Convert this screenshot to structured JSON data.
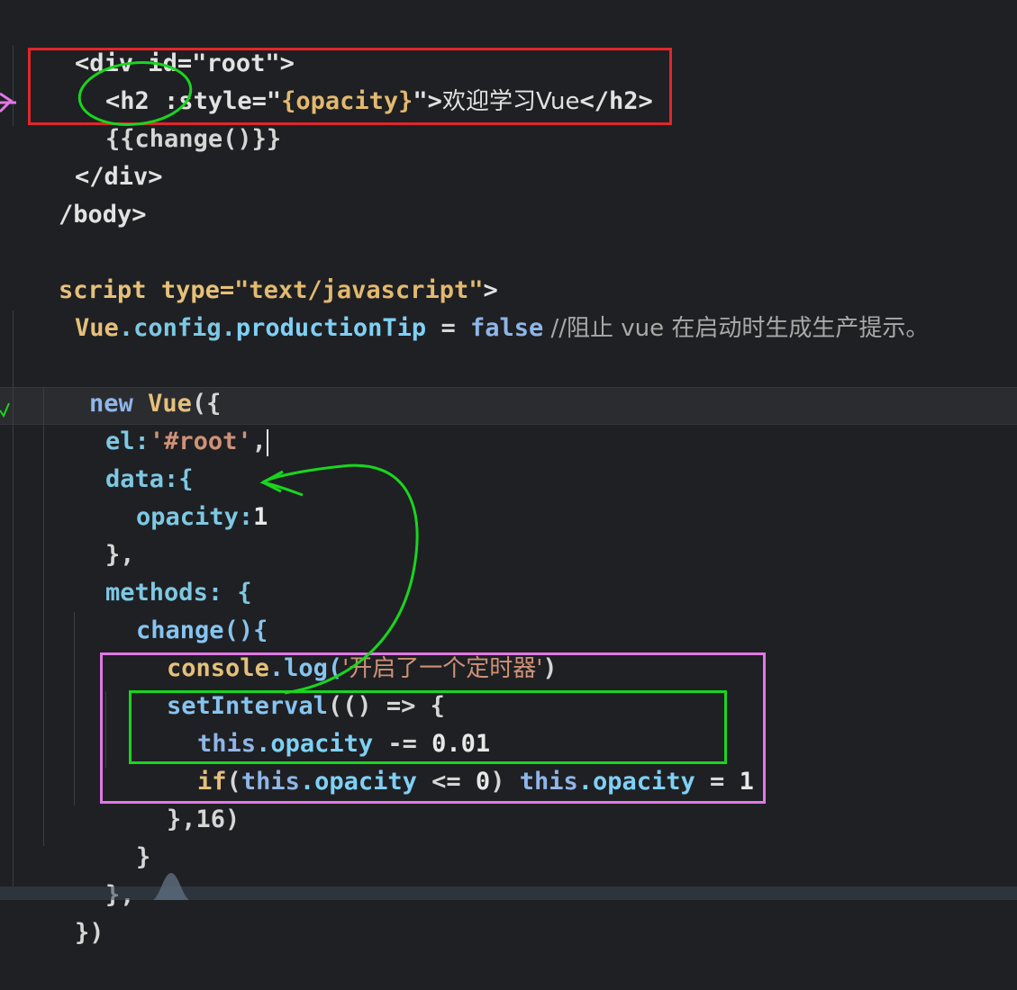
{
  "code_lines": {
    "l1": "<div id=\"root\">",
    "l2_open": "<h2 :style=\"",
    "l2_obj": "{opacity}",
    "l2_q": "\">",
    "l2_text": "欢迎学习Vue",
    "l2_close": "</h2>",
    "l3": "{{change()}}",
    "l4": "</div>",
    "l5": "/body>",
    "l7_script": "script",
    "l7_type": "type=",
    "l7_val": "\"text/javascript\"",
    "l7_end": ">",
    "l8_vue": "Vue",
    "l8_config": ".config.",
    "l8_prop": "productionTip",
    "l8_eq": " = ",
    "l8_false": "false",
    "l8_comment": " //阻止 vue 在启动时生成生产提示。",
    "l10_new": "new",
    "l10_vue": " Vue",
    "l10_paren": "({",
    "l11_el": "el:",
    "l11_val": "'#root'",
    "l11_comma": ",",
    "l12": "data:{",
    "l13_key": "opacity:",
    "l13_val": "1",
    "l14": "},",
    "l15": "methods: {",
    "l16": "change(){",
    "l17_console": "console",
    "l17_log": ".log(",
    "l17_str": "'开启了一个定时器'",
    "l17_end": ")",
    "l18_fn": "setInterval",
    "l18_rest": "(() => {",
    "l19_this": "this",
    "l19_prop": ".opacity",
    "l19_op": " -= ",
    "l19_num": "0.01",
    "l20_if": "if",
    "l20_p1": "(",
    "l20_this": "this",
    "l20_prop": ".opacity",
    "l20_cmp": " <= ",
    "l20_zero": "0",
    "l20_p2": ") ",
    "l20_this2": "this",
    "l20_prop2": ".opacity",
    "l20_eq": " = ",
    "l20_one": "1",
    "l21": "},16)",
    "l22": "}",
    "l23": "},",
    "l24": "})"
  },
  "colors": {
    "background": "#1f2023",
    "red_box": "#e0272a",
    "green_annotation": "#19d51f",
    "magenta_box": "#e277e6"
  },
  "icons": {
    "arrow_marker": "pink-arrow-icon",
    "check_marker": "green-check-icon"
  }
}
